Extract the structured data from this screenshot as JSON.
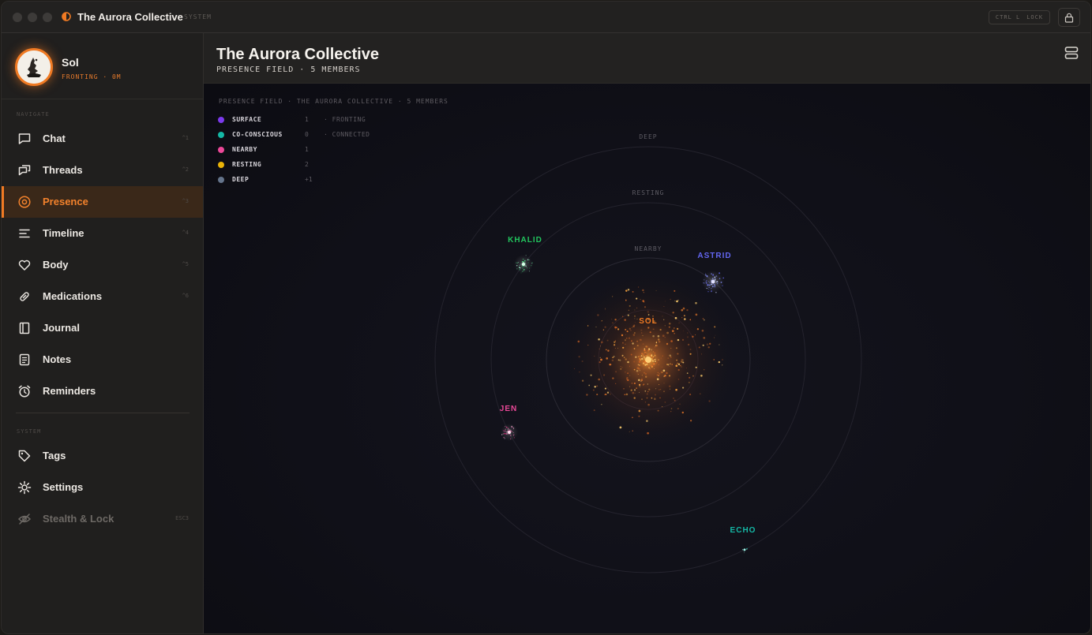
{
  "app": {
    "title": "The Aurora Collective",
    "subtitle": "SYSTEM",
    "shortcut_keys": "CTRL L",
    "shortcut_action": "LOCK"
  },
  "profile": {
    "name": "Sol",
    "status": "FRONTING · 0M"
  },
  "sidebar": {
    "navigate_label": "NAVIGATE",
    "system_label": "SYSTEM",
    "items": [
      {
        "label": "Chat",
        "key": "^1",
        "icon": "chat-bubble-icon"
      },
      {
        "label": "Threads",
        "key": "^2",
        "icon": "threads-icon"
      },
      {
        "label": "Presence",
        "key": "^3",
        "icon": "target-icon"
      },
      {
        "label": "Timeline",
        "key": "^4",
        "icon": "timeline-icon"
      },
      {
        "label": "Body",
        "key": "^5",
        "icon": "heart-icon"
      },
      {
        "label": "Medications",
        "key": "^6",
        "icon": "pill-icon"
      },
      {
        "label": "Journal",
        "key": "",
        "icon": "journal-icon"
      },
      {
        "label": "Notes",
        "key": "",
        "icon": "notes-icon"
      },
      {
        "label": "Reminders",
        "key": "",
        "icon": "alarm-clock-icon"
      }
    ],
    "system_items": [
      {
        "label": "Tags",
        "key": "",
        "icon": "tag-icon"
      },
      {
        "label": "Settings",
        "key": "",
        "icon": "gear-icon"
      },
      {
        "label": "Stealth & Lock",
        "key": "ESC3",
        "icon": "eye-off-icon"
      }
    ]
  },
  "main": {
    "title": "The Aurora Collective",
    "subtitle": "PRESENCE FIELD · 5 MEMBERS"
  },
  "field": {
    "caption": "PRESENCE FIELD · THE AURORA COLLECTIVE · 5 MEMBERS",
    "legend": [
      {
        "name": "SURFACE",
        "count": "1",
        "note": "· FRONTING",
        "color": "#7c3aed"
      },
      {
        "name": "CO-CONSCIOUS",
        "count": "0",
        "note": "· CONNECTED",
        "color": "#14b8a6"
      },
      {
        "name": "NEARBY",
        "count": "1",
        "note": "",
        "color": "#ec4899"
      },
      {
        "name": "RESTING",
        "count": "2",
        "note": "",
        "color": "#eab308"
      },
      {
        "name": "DEEP",
        "count": "+1",
        "note": "",
        "color": "#64748b"
      }
    ],
    "rings": {
      "nearby": "NEARBY",
      "resting": "RESTING",
      "deep": "DEEP"
    },
    "members": [
      {
        "name": "SOL",
        "color": "#f07a23"
      },
      {
        "name": "KHALID",
        "color": "#22c55e"
      },
      {
        "name": "ASTRID",
        "color": "#6366f1"
      },
      {
        "name": "JEN",
        "color": "#ec4899"
      },
      {
        "name": "ECHO",
        "color": "#14b8a6"
      }
    ]
  }
}
